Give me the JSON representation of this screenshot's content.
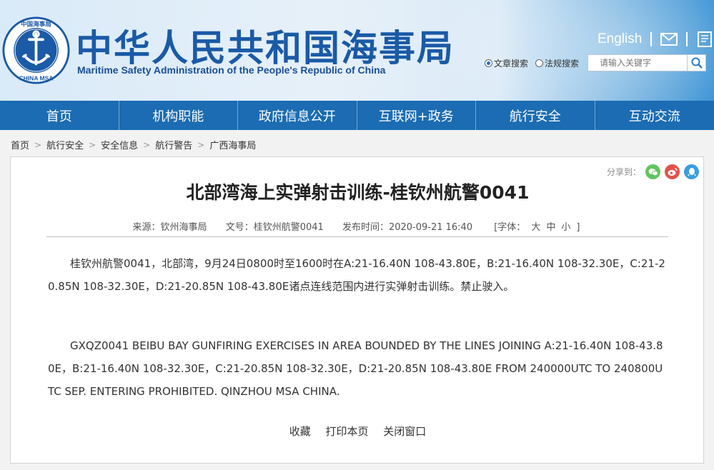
{
  "header": {
    "title_cn": "中华人民共和国海事局",
    "title_en": "Maritime Safety Administration of the People's Republic of China",
    "logo_text_top": "中国海事局",
    "logo_text_bottom": "CHINA MSA",
    "english_link": "English",
    "search": {
      "option_article": "文章搜索",
      "option_law": "法规搜索",
      "selected": "文章搜索",
      "placeholder": "请输入关键字"
    }
  },
  "nav": {
    "items": [
      {
        "label": "首页"
      },
      {
        "label": "机构职能"
      },
      {
        "label": "政府信息公开"
      },
      {
        "label": "互联网+政务"
      },
      {
        "label": "航行安全"
      },
      {
        "label": "互动交流"
      }
    ]
  },
  "breadcrumb": [
    "首页",
    "航行安全",
    "安全信息",
    "航行警告",
    "广西海事局"
  ],
  "article": {
    "share_label": "分享到：",
    "title": "北部湾海上实弹射击训练-桂钦州航警0041",
    "source": "来源：钦州海事局",
    "doc_no": "文号：桂钦州航警0041",
    "publish_time": "发布时间：2020-09-21 16:40",
    "font_label": "[字体：",
    "font_large": "大",
    "font_medium": "中",
    "font_small": "小",
    "font_close": "]",
    "paragraph_cn": "桂钦州航警0041，北部湾，9月24日0800时至1600时在A:21-16.40N 108-43.80E，B:21-16.40N 108-32.30E，C:21-20.85N 108-32.30E，D:21-20.85N 108-43.80E诸点连线范围内进行实弹射击训练。禁止驶入。",
    "paragraph_en": "GXQZ0041 BEIBU BAY GUNFIRING EXERCISES IN AREA BOUNDED BY THE LINES JOINING A:21-16.40N 108-43.80E，B:21-16.40N 108-32.30E，C:21-20.85N 108-32.30E，D:21-20.85N 108-43.80E FROM 240000UTC TO 240800UTC SEP. ENTERING PROHIBITED. QINZHOU MSA CHINA.",
    "action_favorite": "收藏",
    "action_print": "打印本页",
    "action_close": "关闭窗口"
  },
  "colors": {
    "brand_blue": "#1b6cb2",
    "title_blue": "#1a5aa6",
    "wechat_green": "#5fc55f",
    "weibo_red": "#e0534b",
    "qq_blue": "#3a9de0"
  }
}
